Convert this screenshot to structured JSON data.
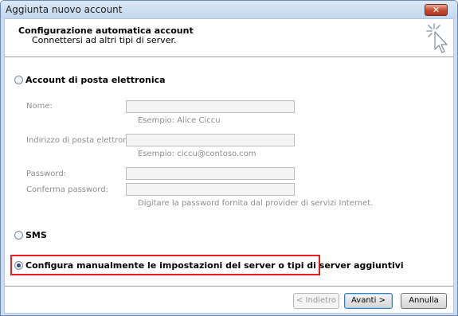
{
  "window": {
    "title": "Aggiunta nuovo account",
    "close_label": "✕"
  },
  "header": {
    "title": "Configurazione automatica account",
    "subtitle": "Connettersi ad altri tipi di server."
  },
  "options": {
    "email_account": "Account di posta elettronica",
    "sms": "SMS",
    "manual": "Configura manualmente le impostazioni del server o tipi di server aggiuntivi",
    "selected": "manual"
  },
  "form": {
    "name_label": "Nome:",
    "name_value": "",
    "name_hint": "Esempio: Alice Ciccu",
    "email_label": "Indirizzo di posta elettronica:",
    "email_value": "",
    "email_hint": "Esempio: ciccu@contoso.com",
    "password_label": "Password:",
    "password_value": "",
    "confirm_label": "Conferma password:",
    "confirm_value": "",
    "password_hint": "Digitare la password fornita dal provider di servizi Internet."
  },
  "buttons": {
    "back": "< Indietro",
    "next": "Avanti >",
    "cancel": "Annulla"
  },
  "colors": {
    "highlight": "#e81e1e",
    "title_bar": "#c3d8ee",
    "disabled_text": "#8d8d8d"
  }
}
